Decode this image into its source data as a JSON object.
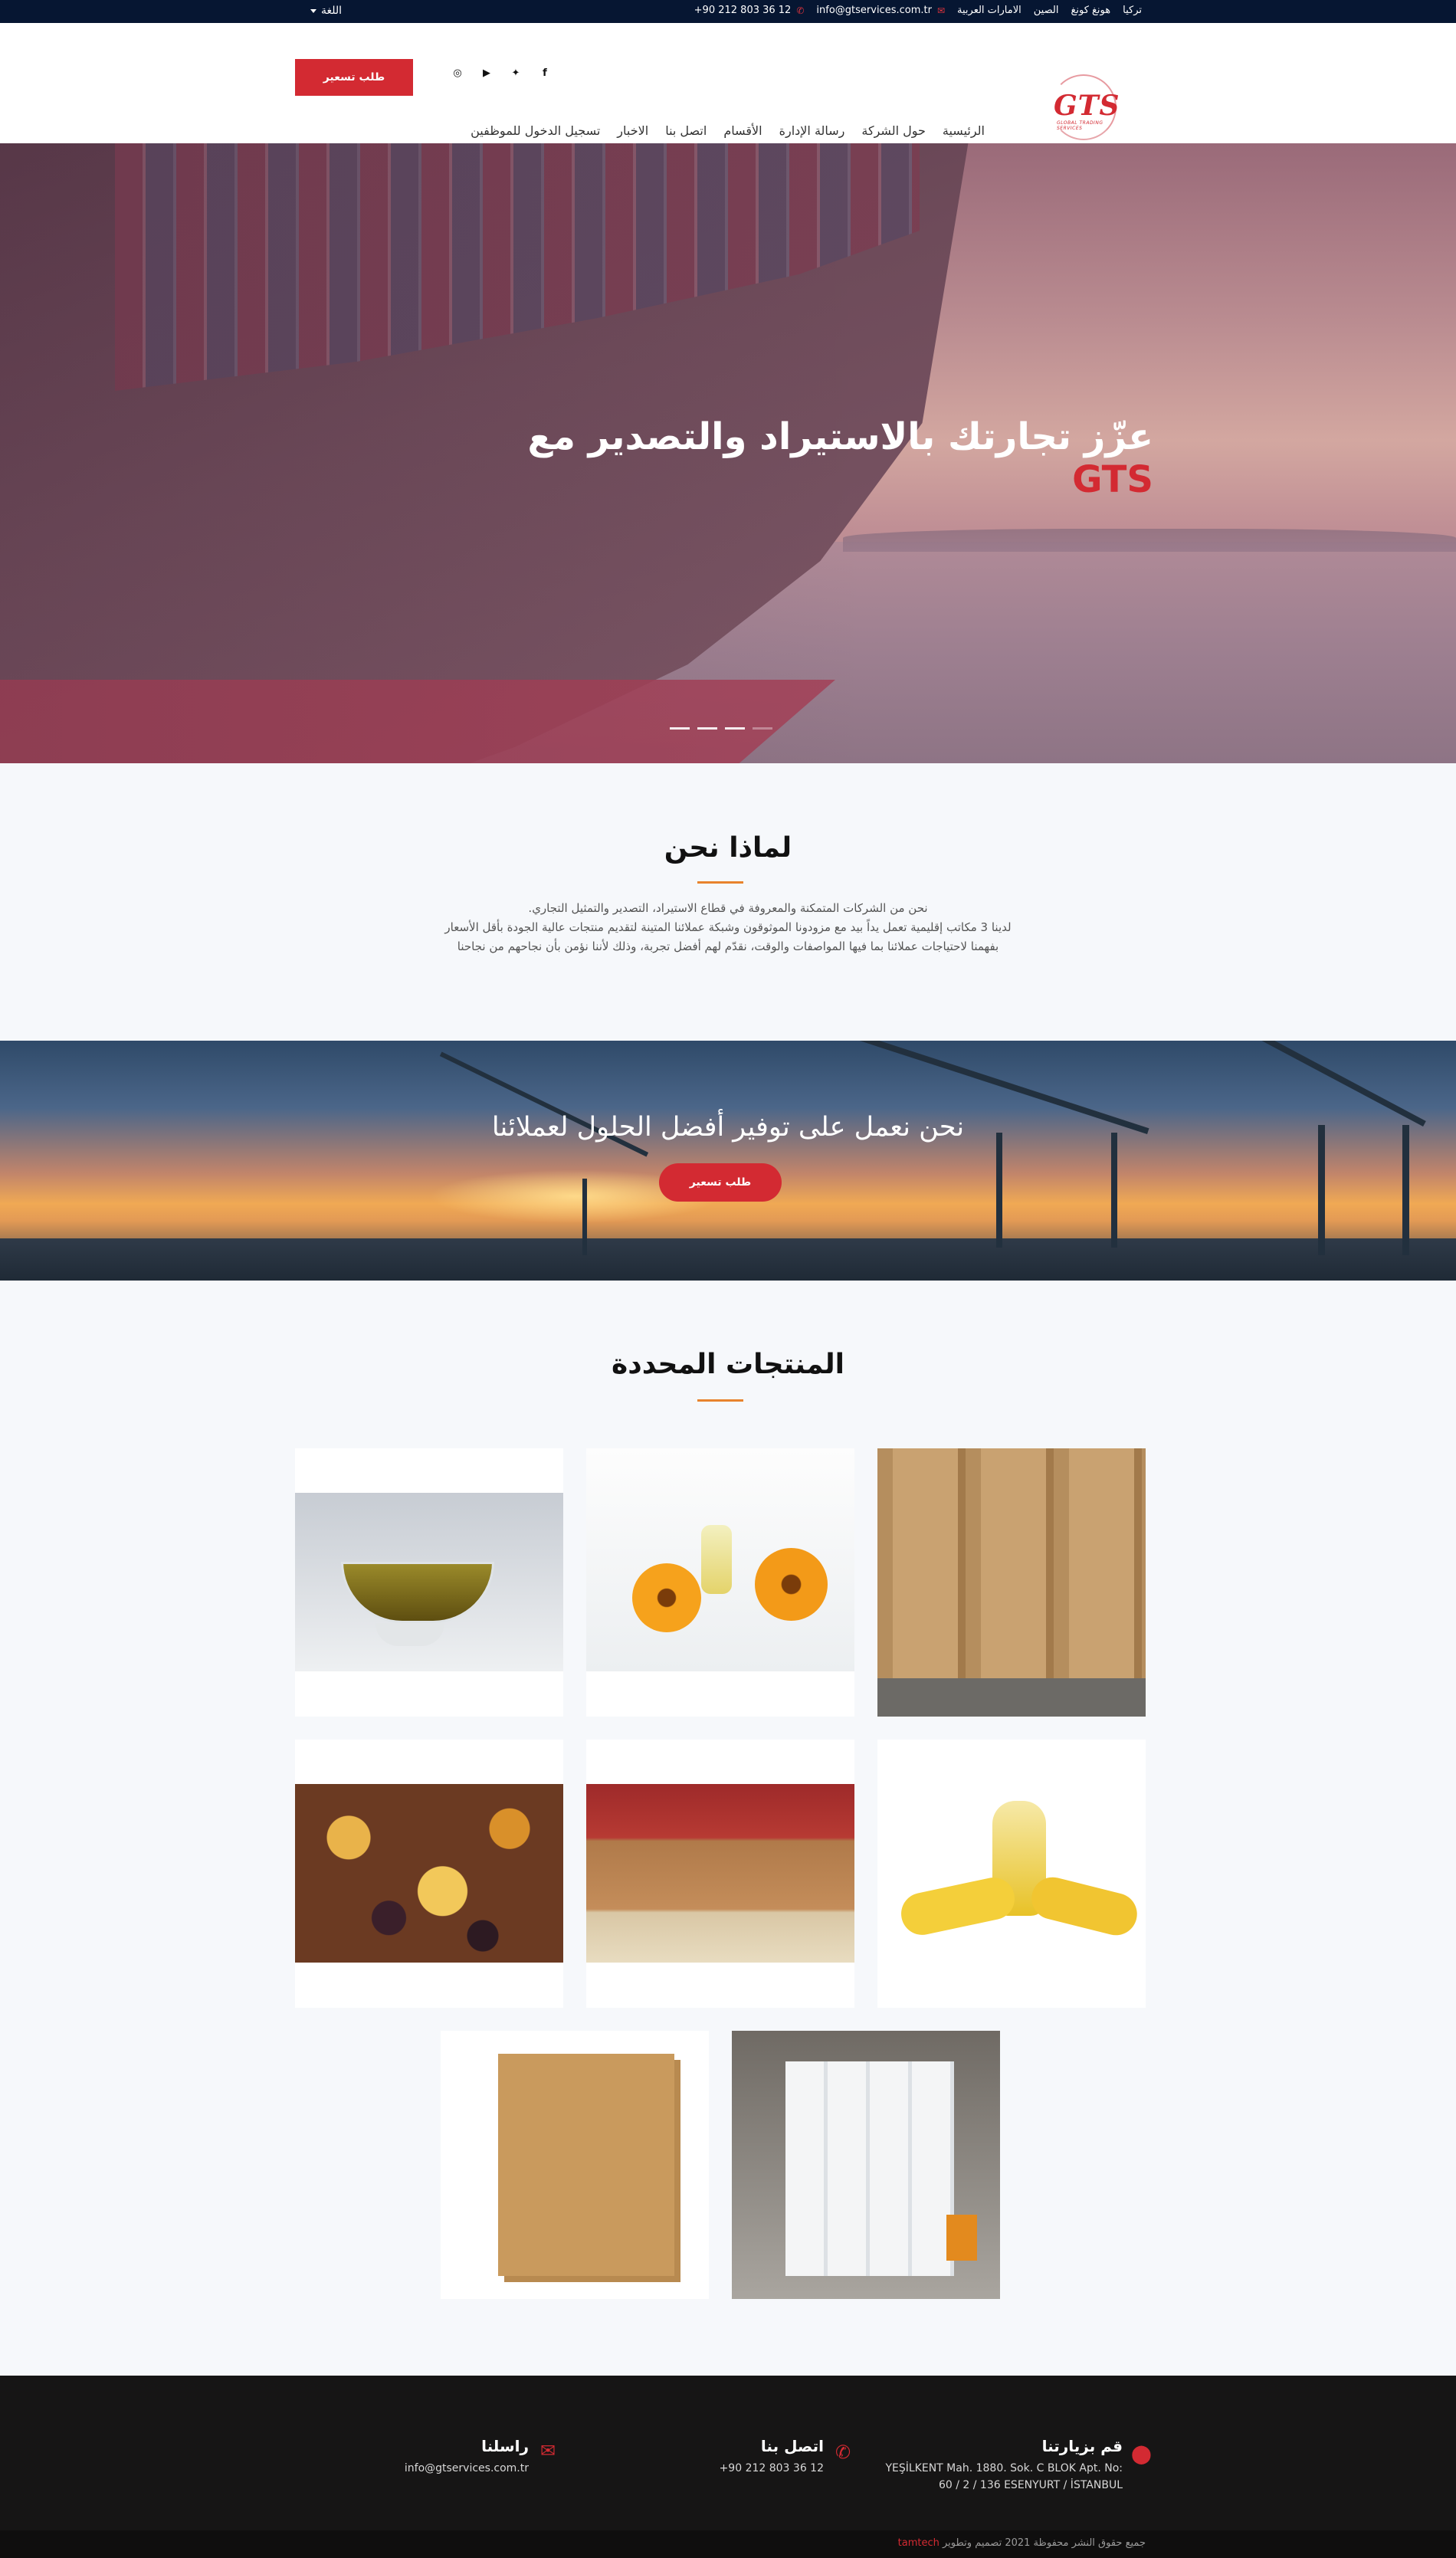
{
  "topbar": {
    "language_label": "اللغة",
    "countries": [
      "تركيا",
      "هونغ كونغ",
      "الصين",
      "الامارات العربية"
    ],
    "email": "info@gtservices.com.tr",
    "phone": "+90 212 803 36 12"
  },
  "header": {
    "quote_button": "طلب تسعير",
    "logo_text": "GTS",
    "logo_subtext": "GLOBAL TRADING SERVICES",
    "social_icons": [
      "facebook-icon",
      "twitter-icon",
      "youtube-icon",
      "instagram-icon"
    ],
    "nav": [
      "الرئيسية",
      "حول الشركة",
      "رسالة الإدارة",
      "الأقسام",
      "اتصل بنا",
      "الاخبار",
      "تسجيل الدخول للموظفين"
    ]
  },
  "hero": {
    "title": "عزّز تجارتك بالاستيراد والتصدير مع",
    "title_brand": "GTS",
    "slides_total": 4,
    "active_slide": 4
  },
  "why": {
    "title": "لماذا نحن",
    "lines": [
      "نحن من الشركات المتمكنة والمعروفة في قطاع الاستيراد، التصدير والتمثيل التجاري.",
      "لدينا 3 مكاتب إقليمية تعمل يداً بيد مع مزودونا الموثوقون وشبكة عملائنا المتينة لتقديم منتجات عالية الجودة بأقل الأسعار",
      "بفهمنا لاحتياجات عملائنا بما فيها المواصفات والوقت، نقدّم لهم أفضل تجربة، وذلك لأننا نؤمن بأن نجاحهم من نجاحنا"
    ]
  },
  "banner": {
    "title": "نحن نعمل على توفير أفضل الحلول لعملائنا",
    "button": "طلب تسعير"
  },
  "products": {
    "title": "المنتجات المحددة",
    "items": [
      "olive-oil",
      "sunflower-oil",
      "kraft-paper-rolls",
      "dried-fruits",
      "nuts-market",
      "corn-oil",
      "cardboard-sheets",
      "tissue-paper-rolls"
    ]
  },
  "footer": {
    "visit_title": "قم بزيارتنا",
    "visit_address_1": "YEŞİLKENT Mah. 1880. Sok. C BLOK Apt. No:",
    "visit_address_2": "60 / 2 / 136 ESENYURT / İSTANBUL",
    "call_title": "اتصل بنا",
    "call_phone": "+90 212 803 36 12",
    "mail_title": "راسلنا",
    "mail_email": "info@gtservices.com.tr",
    "copyright": "جميع حقوق النشر محفوظة 2021 تصميم وتطوير",
    "developer": "tamtech"
  },
  "colors": {
    "accent_red": "#d32a32",
    "topbar": "#061632",
    "underline": "#e8832d",
    "footer": "#161515"
  }
}
